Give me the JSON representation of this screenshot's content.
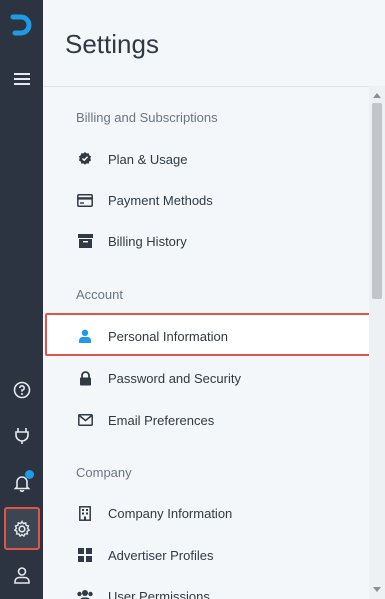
{
  "page": {
    "title": "Settings"
  },
  "rail": {
    "icons": [
      "logo-icon",
      "menu-icon",
      "help-icon",
      "plug-icon",
      "bell-icon",
      "settings-icon",
      "user-icon"
    ],
    "notification": true,
    "active_item": "settings"
  },
  "sections": [
    {
      "label": "Billing and Subscriptions",
      "items": [
        {
          "label": "Plan & Usage",
          "icon": "badge-check-icon"
        },
        {
          "label": "Payment Methods",
          "icon": "credit-card-icon"
        },
        {
          "label": "Billing History",
          "icon": "archive-box-icon"
        }
      ]
    },
    {
      "label": "Account",
      "items": [
        {
          "label": "Personal Information",
          "icon": "person-icon",
          "selected": true
        },
        {
          "label": "Password and Security",
          "icon": "lock-icon"
        },
        {
          "label": "Email Preferences",
          "icon": "envelope-icon"
        }
      ]
    },
    {
      "label": "Company",
      "items": [
        {
          "label": "Company Information",
          "icon": "building-icon"
        },
        {
          "label": "Advertiser Profiles",
          "icon": "grid-icon"
        },
        {
          "label": "User Permissions",
          "icon": "users-icon"
        }
      ]
    }
  ],
  "colors": {
    "rail_bg": "#2b3440",
    "panel_bg": "#f3f7f9",
    "accent": "#1f9be6",
    "highlight_border": "#e0554a",
    "text": "#2f3a45",
    "section_text": "#6b7580"
  }
}
